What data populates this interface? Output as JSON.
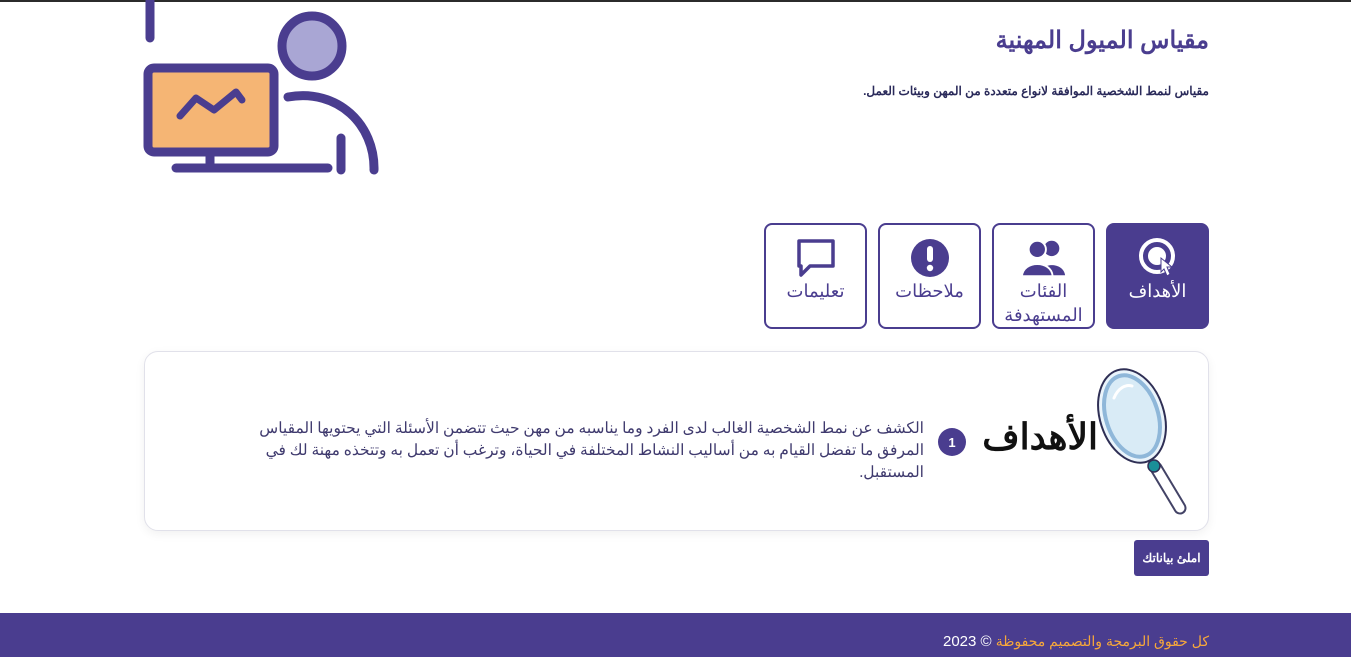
{
  "header": {
    "title": "مقياس الميول المهنية",
    "subtitle": "مقياس لنمط الشخصية الموافقة لانواع متعددة من المهن وبيئات العمل."
  },
  "tabs": [
    {
      "label": "الأهداف",
      "icon": "target-icon",
      "active": true
    },
    {
      "label": "الفئات المستهدفة",
      "icon": "users-icon",
      "active": false
    },
    {
      "label": "ملاحظات",
      "icon": "exclamation-icon",
      "active": false
    },
    {
      "label": "تعليمات",
      "icon": "chat-icon",
      "active": false
    }
  ],
  "goals_card": {
    "title": "الأهداف",
    "badge": "1",
    "text": "الكشف عن نمط الشخصية الغالب لدى الفرد وما يناسبه من مهن حيث تتضمن الأسئلة التي يحتويها المقياس المرفق ما تفضل القيام به من أساليب النشاط المختلفة في الحياة، وترغب أن تعمل به وتتخذه مهنة لك في المستقبل."
  },
  "actions": {
    "fill_data_label": "املئ بياناتك"
  },
  "footer": {
    "rights_text": "كل حقوق البرمجة والتصميم محفوظة",
    "copyright": "© 2023"
  },
  "colors": {
    "primary": "#4a3d8f",
    "accent_orange": "#f7a83a",
    "illustration_screen": "#f5b574",
    "illustration_head": "#a9a6d4"
  }
}
